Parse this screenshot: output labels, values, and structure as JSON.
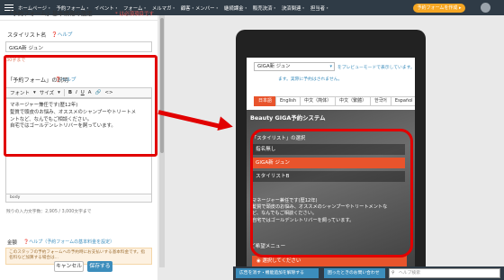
{
  "topnav": {
    "items": [
      "ホームページ・",
      "予約フォーム・",
      "イベント・",
      "フォーム・",
      "メルマガ・",
      "顧客・メンバー・",
      "継続課金・",
      "販売決済・",
      "決済関連・",
      "担当者・"
    ],
    "cta_label": "予約フォームを作成 ▸"
  },
  "left_panel": {
    "title": "「予約フォーム」基本情報の設定",
    "required_note": "* は必須項目です",
    "name_label": "スタイリスト名",
    "help_label": "❓ヘルプ",
    "name_value": "GIGA新 ジュン",
    "name_hint": "30字まで",
    "desc_label": "「予約フォーム」の説明",
    "desc_help": "❓ヘルプ",
    "toolbar": {
      "font": "フォント",
      "size": "サイズ",
      "bold": "B",
      "italic": "I",
      "underline": "U",
      "color": "A",
      "link": "🔗",
      "code": "<>"
    },
    "desc_lines": [
      "マネージャー兼任です(歴12年)",
      "髪質で頭皮のお悩み、オススメのシャンプーやトリートメ",
      "ントなど、なんでもご相談ください。",
      "自宅ではゴールデンレトリバーを飼っています。"
    ],
    "editor_footer": "body",
    "char_count": "残りの入力文字数：2,905 / 3,000文字まで",
    "price_label": "金額",
    "price_help": "❓ヘルプ（予約フォームの基本料金を設定）",
    "notice": "このスタッフの予約フォームへの予約時にお支払いする基本料金です。指名料など加算する場合は..."
  },
  "actions": {
    "cancel": "キャンセル",
    "save": "保存する"
  },
  "preview": {
    "store_select": "GIGA新 ジュン",
    "preview_link": "をプレビューモードで表示しています。",
    "preview_note": "ます。実際に予約はされません。",
    "lang_tabs": [
      "日本語",
      "English",
      "中文（简体）",
      "中文（繁體）",
      "한국어",
      "Español"
    ],
    "hero_title": "Beauty GIGA予約システム",
    "section_head": "「スタイリスト」の選択",
    "options": [
      "指名無し",
      "GIGA新 ジュン",
      "スタイリストB"
    ],
    "selected_index": 1,
    "desc_lines": [
      "マネージャー兼任です(歴12年)",
      "髪質で頭皮のお悩み、オススメのシャンプーやトリートメントな",
      "ど、なんでもご相談ください。",
      "自宅ではゴールデンレトリバーを飼っています。"
    ],
    "menu_head": "ご希望メニュー",
    "menu_select": "◉ 選択してください"
  },
  "floatbar": {
    "btn1": "広告を消す・機能追加を解除する",
    "btn2": "困ったときのお問い合わせ",
    "search_placeholder": "ヘルプ検索"
  },
  "colors": {
    "accent": "#3c8dbc",
    "orange": "#e8542c",
    "highlight": "#e10000",
    "nav": "#2f3b46"
  }
}
